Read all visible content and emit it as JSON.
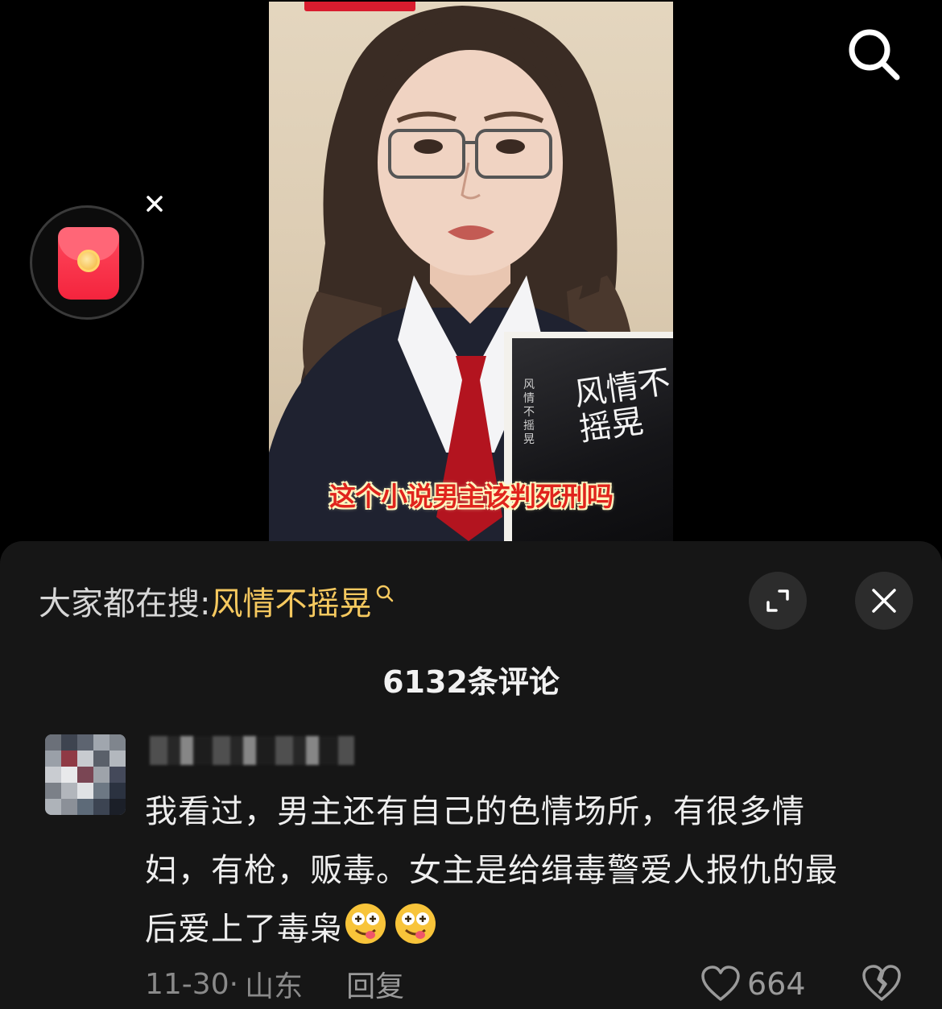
{
  "video": {
    "caption": "这个小说男主该判死刑吗",
    "book_title": "风情不摇晃",
    "book_spine": "风情不摇晃"
  },
  "trending_search": {
    "label": "大家都在搜:",
    "query": "风情不摇晃"
  },
  "comments": {
    "count_label": "6132条评论",
    "items": [
      {
        "text_lines": [
          "我看过，男主还有自己的色情场所，有很多情",
          "妇，有枪，贩毒。女主是给缉毒警爱人报仇的最",
          "后爱上了毒枭"
        ],
        "date": "11-30·",
        "location": "山东",
        "reply_label": "回复",
        "likes": "664"
      }
    ]
  },
  "icons": {
    "search": "search-icon",
    "red_packet": "red-packet-icon",
    "close": "close-icon",
    "expand": "expand-icon",
    "heart": "heart-icon",
    "dislike": "broken-heart-icon",
    "emoji": "dizzy-face-emoji"
  },
  "colors": {
    "highlight": "#f6c95f",
    "sheet_bg": "#161616",
    "caption_red": "#e0241d"
  }
}
